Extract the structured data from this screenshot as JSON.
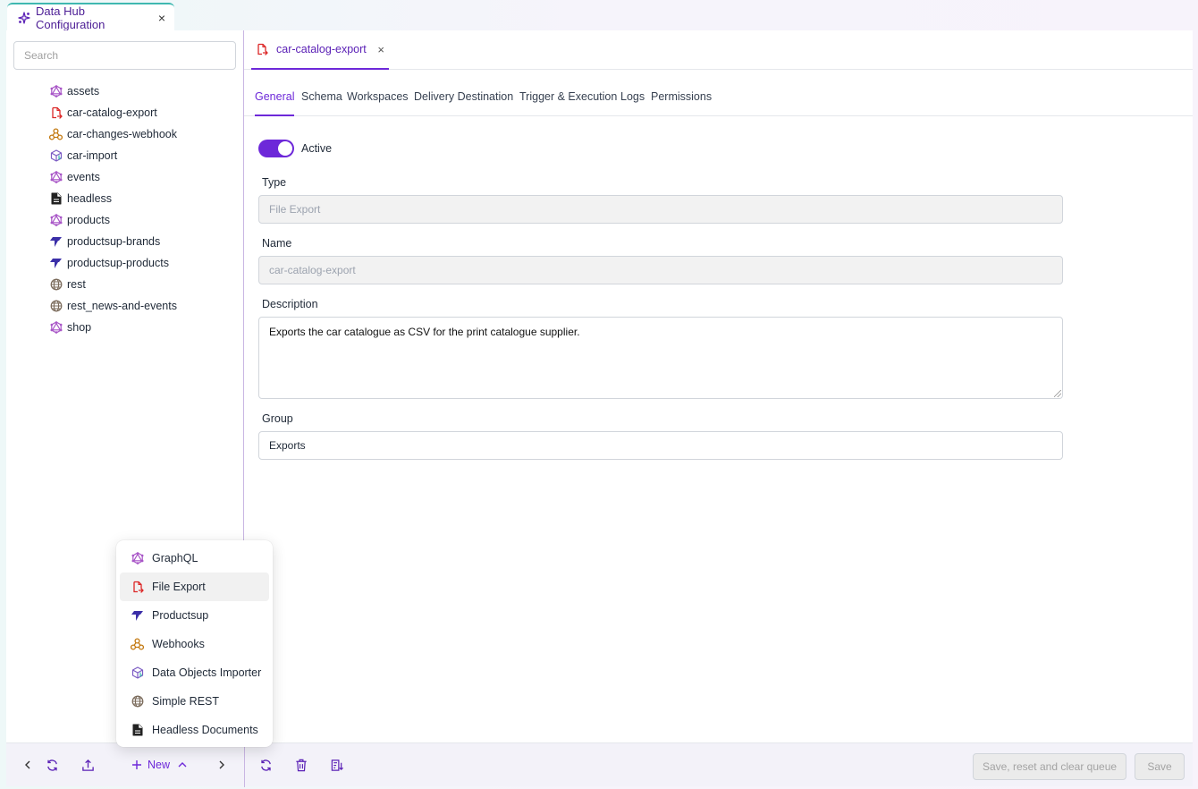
{
  "window_tab": {
    "title": "Data Hub Configuration",
    "close": "×"
  },
  "sidebar": {
    "search_placeholder": "Search",
    "items": [
      {
        "label": "assets",
        "icon": "graphql-icon"
      },
      {
        "label": "car-catalog-export",
        "icon": "file-export-icon"
      },
      {
        "label": "car-changes-webhook",
        "icon": "webhook-icon"
      },
      {
        "label": "car-import",
        "icon": "data-importer-icon"
      },
      {
        "label": "events",
        "icon": "graphql-icon"
      },
      {
        "label": "headless",
        "icon": "headless-document-icon"
      },
      {
        "label": "products",
        "icon": "graphql-icon"
      },
      {
        "label": "productsup-brands",
        "icon": "productsup-icon"
      },
      {
        "label": "productsup-products",
        "icon": "productsup-icon"
      },
      {
        "label": "rest",
        "icon": "globe-icon"
      },
      {
        "label": "rest_news-and-events",
        "icon": "globe-icon"
      },
      {
        "label": "shop",
        "icon": "graphql-icon"
      }
    ]
  },
  "editor": {
    "doc_tab": {
      "label": "car-catalog-export",
      "close": "×"
    },
    "tabs": [
      "General",
      "Schema",
      "Workspaces",
      "Delivery Destination",
      "Trigger & Execution",
      "Logs",
      "Permissions"
    ],
    "active_tab": "General",
    "active_toggle": {
      "label": "Active",
      "on": true
    },
    "type": {
      "label": "Type",
      "value": "File Export"
    },
    "name": {
      "label": "Name",
      "value": "car-catalog-export"
    },
    "description": {
      "label": "Description",
      "value": "Exports the car catalogue as CSV for the print catalogue supplier."
    },
    "group": {
      "label": "Group",
      "value": "Exports"
    }
  },
  "new_menu": {
    "items": [
      {
        "label": "GraphQL",
        "icon": "graphql-icon"
      },
      {
        "label": "File Export",
        "icon": "file-export-icon"
      },
      {
        "label": "Productsup",
        "icon": "productsup-icon"
      },
      {
        "label": "Webhooks",
        "icon": "webhook-icon"
      },
      {
        "label": "Data Objects Importer",
        "icon": "data-importer-icon"
      },
      {
        "label": "Simple REST",
        "icon": "globe-icon"
      },
      {
        "label": "Headless Documents",
        "icon": "headless-document-icon"
      }
    ],
    "hovered": "File Export"
  },
  "bottom_bar": {
    "new_label": "New",
    "save_reset_label": "Save, reset and clear queue",
    "save_label": "Save"
  },
  "colors": {
    "accent": "#6d28d9",
    "graphql": "#a855c7",
    "file_export": "#dc2626",
    "webhook": "#c2770d",
    "productsup": "#3b2fa8"
  }
}
